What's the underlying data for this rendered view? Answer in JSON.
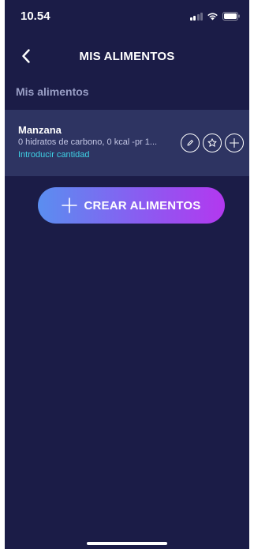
{
  "status_bar": {
    "time": "10.54",
    "icons": [
      "signal-icon",
      "wifi-icon",
      "battery-icon"
    ]
  },
  "nav": {
    "back_icon": "chevron-left-icon",
    "title": "MIS ALIMENTOS"
  },
  "section": {
    "header": "Mis alimentos"
  },
  "food_items": [
    {
      "name": "Manzana",
      "details": "0 hidratos de carbono, 0 kcal -pr 1...",
      "link": "Introducir cantidad",
      "actions": [
        "edit-icon",
        "star-icon",
        "add-icon"
      ]
    }
  ],
  "create_button": {
    "icon": "plus-icon",
    "label": "CREAR ALIMENTOS"
  },
  "colors": {
    "background": "#1b1c47",
    "card": "#2e3462",
    "link": "#3fd2e6",
    "button_gradient_start": "#5a8ef0",
    "button_gradient_end": "#b338ef"
  }
}
